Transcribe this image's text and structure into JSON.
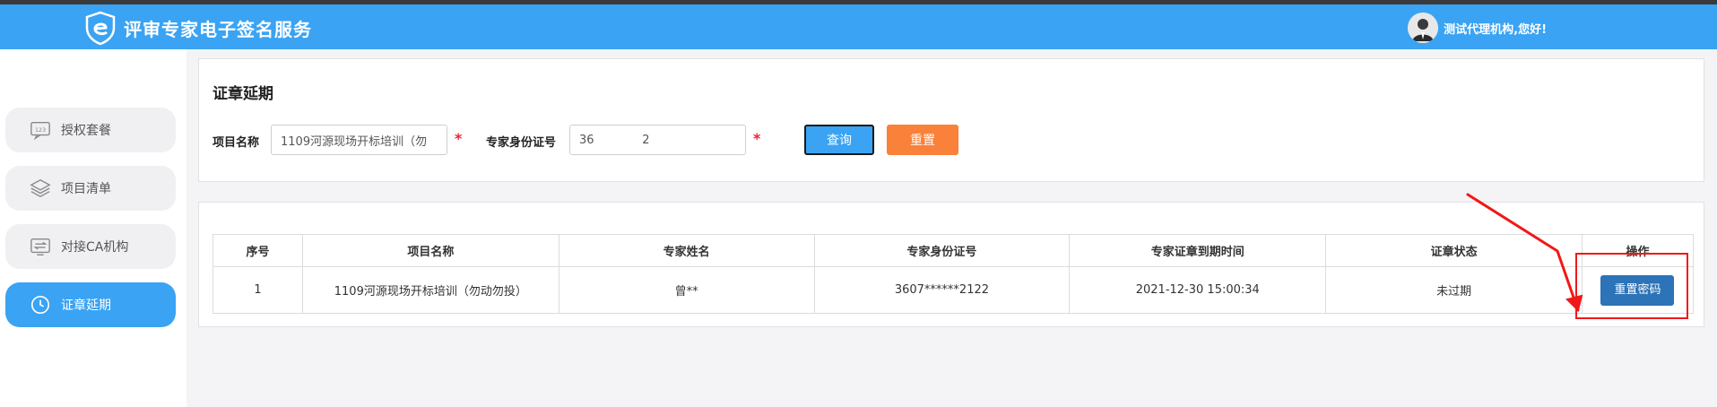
{
  "header": {
    "brand": "评审专家电子签名服务",
    "greeting": "测试代理机构,您好!"
  },
  "sidebar": {
    "items": [
      {
        "label": "授权套餐",
        "icon": "package-icon"
      },
      {
        "label": "项目清单",
        "icon": "layers-icon"
      },
      {
        "label": "对接CA机构",
        "icon": "exchange-icon"
      },
      {
        "label": "证章延期",
        "icon": "clock-icon",
        "active": true
      }
    ]
  },
  "search": {
    "title": "证章延期",
    "project_label": "项目名称",
    "project_value": "1109河源现场开标培训（勿",
    "id_label": "专家身份证号",
    "id_value": "36             2",
    "required_mark": "*",
    "query_button": "查询",
    "reset_button": "重置"
  },
  "table": {
    "headers": [
      "序号",
      "项目名称",
      "专家姓名",
      "专家身份证号",
      "专家证章到期时间",
      "证章状态",
      "操作"
    ],
    "rows": [
      {
        "index": "1",
        "project": "1109河源现场开标培训（勿动勿投）",
        "name": "曾**",
        "id": "3607******2122",
        "expire": "2021-12-30 15:00:34",
        "status": "未过期",
        "action": "重置密码"
      }
    ]
  },
  "colors": {
    "header_bg": "#3aa3f3",
    "active_nav": "#3aa3f3",
    "reset_btn": "#f9813a",
    "action_btn": "#2d73b7",
    "annotation": "#f01818"
  }
}
